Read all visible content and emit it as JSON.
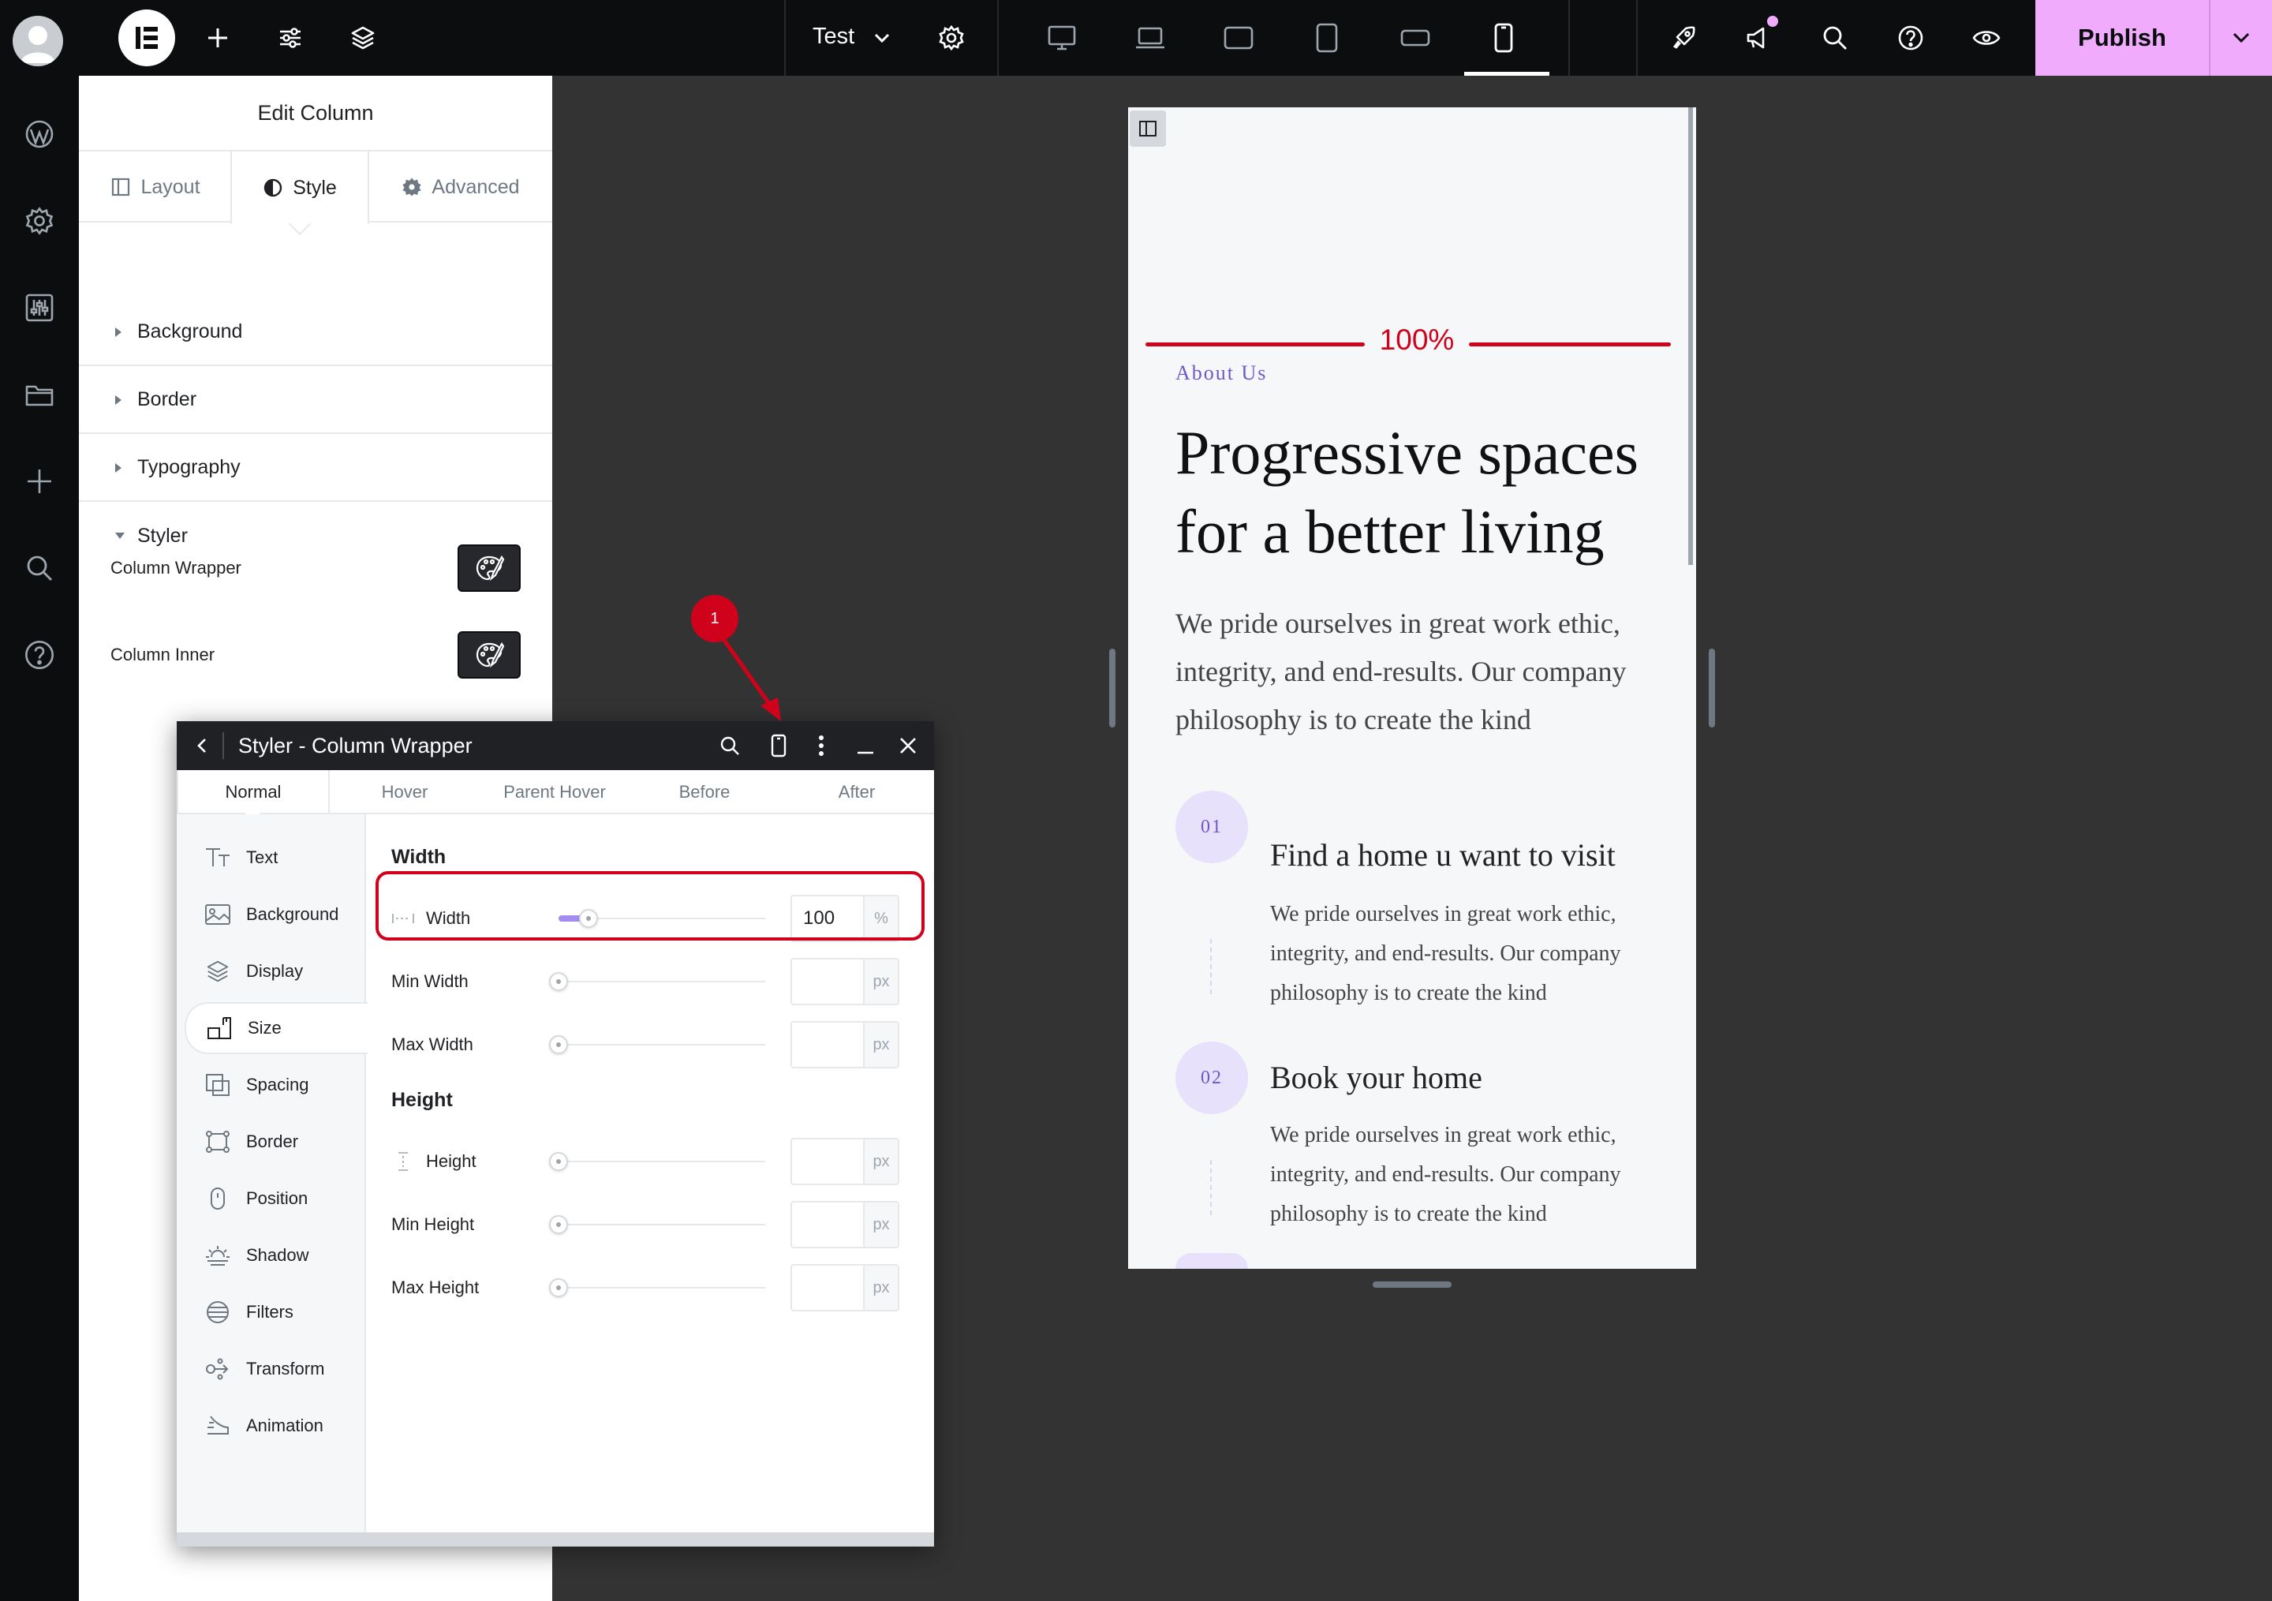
{
  "topbar": {
    "document_title": "Test",
    "publish_label": "Publish",
    "icons": [
      "plus-icon",
      "sliders-icon",
      "layers-icon",
      "gear-icon",
      "desktop-icon",
      "laptop-icon",
      "tablet-landscape-icon",
      "tablet-portrait-icon",
      "mobile-landscape-icon",
      "mobile-portrait-icon",
      "rocket-icon",
      "megaphone-icon",
      "search-icon",
      "help-icon",
      "eye-icon",
      "chevron-down-icon"
    ],
    "colors": {
      "bar": "#0c0d0e",
      "publish": "#f0abfc",
      "notification_dot": "#f0abfc"
    }
  },
  "rail": {
    "icons": [
      "wordpress-icon",
      "settings-icon",
      "sliders-box-icon",
      "folder-icon",
      "plus-icon",
      "search-icon",
      "help-icon"
    ]
  },
  "panel": {
    "title": "Edit Column",
    "tabs": [
      {
        "label": "Layout",
        "icon": "layout-icon"
      },
      {
        "label": "Style",
        "icon": "contrast-icon"
      },
      {
        "label": "Advanced",
        "icon": "gear-icon"
      }
    ],
    "sections": [
      "Background",
      "Border",
      "Typography",
      "Styler"
    ],
    "styler_controls": [
      {
        "label": "Column Wrapper",
        "icon": "palette-icon"
      },
      {
        "label": "Column Inner",
        "icon": "palette-icon"
      }
    ]
  },
  "preview": {
    "width_indicator": "100%",
    "eyebrow": "About Us",
    "headline": "Progressive spaces for a better living",
    "intro": "We pride ourselves in great work ethic, integrity, and end-results. Our company philosophy is to create the kind",
    "steps": [
      {
        "number": "01",
        "title": "Find a home u want to visit",
        "text": "We pride ourselves in great work ethic, integrity, and end-results. Our company philosophy is to create the kind"
      },
      {
        "number": "02",
        "title": "Book your home",
        "text": "We pride ourselves in great work ethic, integrity, and end-results. Our company philosophy is to create the kind"
      }
    ],
    "colors": {
      "accent": "#6e58c7",
      "circle": "#e8e1fb",
      "indicator": "#d0021b"
    }
  },
  "styler": {
    "title": "Styler - Column Wrapper",
    "state_tabs": [
      "Normal",
      "Hover",
      "Parent Hover",
      "Before",
      "After"
    ],
    "nav": [
      {
        "label": "Text",
        "icon": "text-icon"
      },
      {
        "label": "Background",
        "icon": "image-icon"
      },
      {
        "label": "Display",
        "icon": "layers-icon"
      },
      {
        "label": "Size",
        "icon": "size-icon"
      },
      {
        "label": "Spacing",
        "icon": "spacing-icon"
      },
      {
        "label": "Border",
        "icon": "border-icon"
      },
      {
        "label": "Position",
        "icon": "position-icon"
      },
      {
        "label": "Shadow",
        "icon": "shadow-icon"
      },
      {
        "label": "Filters",
        "icon": "filters-icon"
      },
      {
        "label": "Transform",
        "icon": "transform-icon"
      },
      {
        "label": "Animation",
        "icon": "animation-icon"
      }
    ],
    "width_group": {
      "title": "Width",
      "rows": [
        {
          "label": "Width",
          "value": "100",
          "unit": "%",
          "slider_fraction": 0.1
        },
        {
          "label": "Min Width",
          "value": "",
          "unit": "px",
          "slider_fraction": 0
        },
        {
          "label": "Max Width",
          "value": "",
          "unit": "px",
          "slider_fraction": 0
        }
      ]
    },
    "height_group": {
      "title": "Height",
      "rows": [
        {
          "label": "Height",
          "value": "",
          "unit": "px",
          "slider_fraction": 0
        },
        {
          "label": "Min Height",
          "value": "",
          "unit": "px",
          "slider_fraction": 0
        },
        {
          "label": "Max Height",
          "value": "",
          "unit": "px",
          "slider_fraction": 0
        }
      ]
    }
  },
  "annotation": {
    "badge": "1"
  }
}
